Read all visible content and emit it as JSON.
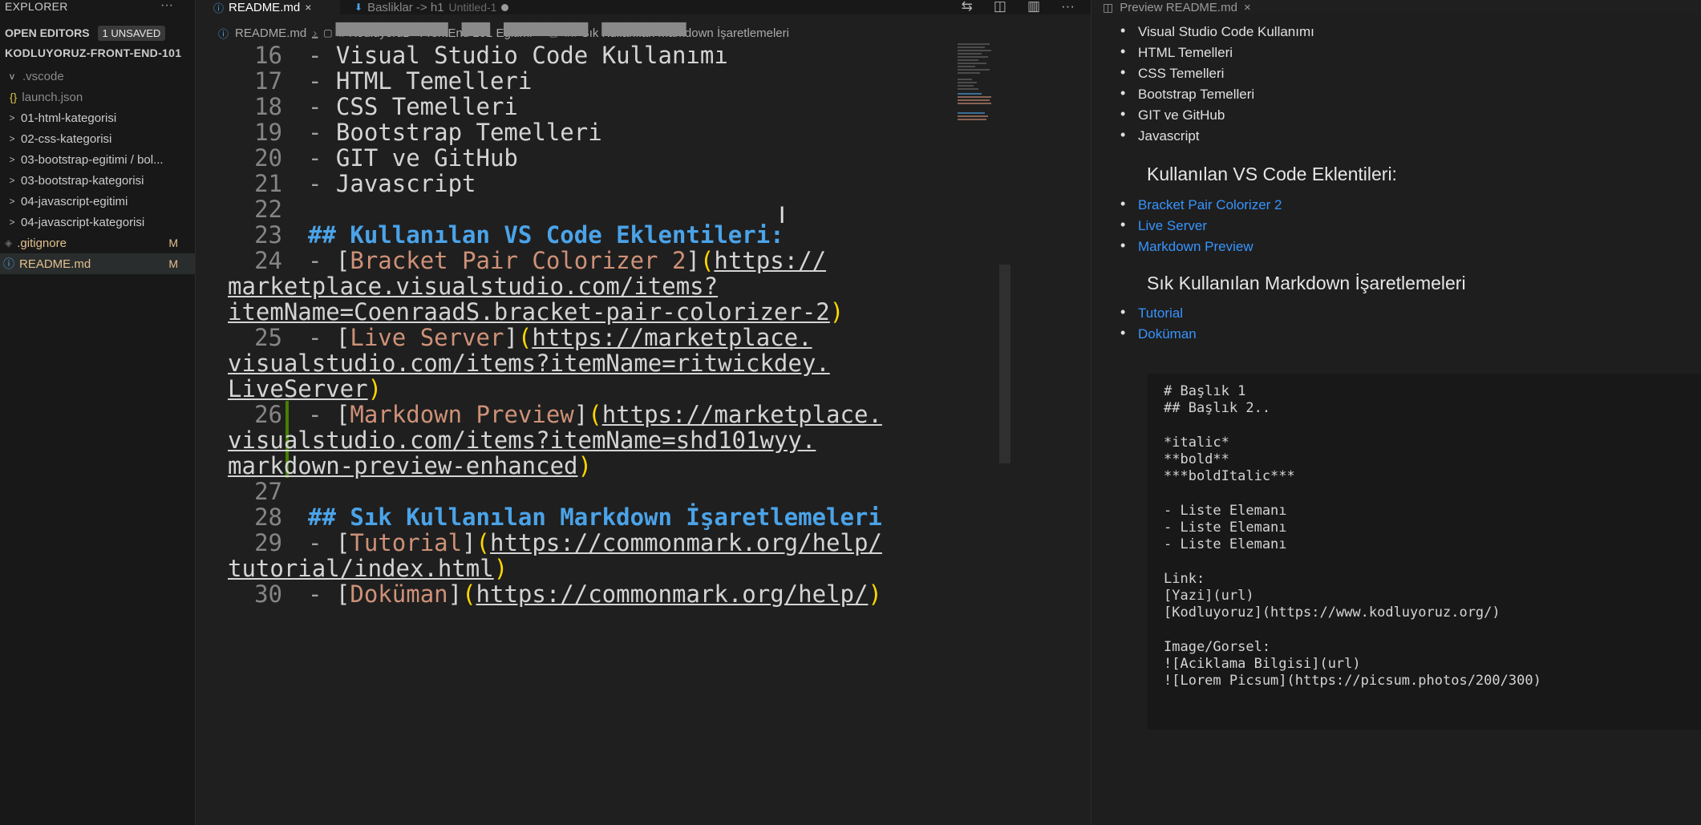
{
  "sidebar": {
    "title": "EXPLORER",
    "more": "···",
    "open_editors": {
      "label": "OPEN EDITORS",
      "badge": "1 UNSAVED"
    },
    "root": "KODLUYORUZ-FRONT-END-101",
    "items": [
      {
        "label": ".vscode",
        "chevron": "v"
      },
      {
        "label": "launch.json",
        "icon": "{}"
      },
      {
        "label": "01-html-kategorisi",
        "chevron": ">"
      },
      {
        "label": "02-css-kategorisi",
        "chevron": ">"
      },
      {
        "label": "03-bootstrap-egitimi / bol...",
        "chevron": ">"
      },
      {
        "label": "03-bootstrap-kategorisi",
        "chevron": ">"
      },
      {
        "label": "04-javascript-egitimi",
        "chevron": ">"
      },
      {
        "label": "04-javascript-kategorisi",
        "chevron": ">"
      },
      {
        "label": ".gitignore",
        "status": "M",
        "icon": "◈"
      },
      {
        "label": "README.md",
        "status": "M",
        "icon": "ⓘ"
      }
    ]
  },
  "tabs": [
    {
      "label": "README.md",
      "close": "×"
    },
    {
      "label": "Basliklar -> h1",
      "secondary": "Untitled-1"
    }
  ],
  "preview_tab": {
    "label": "Preview README.md",
    "close": "×"
  },
  "toolbar": {
    "icons": [
      "compare-icon",
      "open-preview-icon",
      "split-editor-icon",
      "more-actions-icon"
    ],
    "more": "···"
  },
  "breadcrumb": [
    "README.md",
    "# Kodluyoruz - FrontEnd 101 Eğitimi",
    "## Sık Kullanılan Markdown İşaretlemeleri"
  ],
  "editor": {
    "line_numbers": {
      "l16": "16",
      "l17": "17",
      "l18": "18",
      "l19": "19",
      "l20": "20",
      "l21": "21",
      "l22": "22",
      "l23": "23",
      "l24": "24",
      "l25": "25",
      "l26": "26",
      "l27": "27",
      "l28": "28",
      "l29": "29",
      "l30": "30"
    },
    "lines": {
      "l16": "Visual Studio Code Kullanımı",
      "l17": "HTML Temelleri",
      "l18": "CSS Temelleri",
      "l19": "Bootstrap Temelleri",
      "l20": "GIT ve GitHub",
      "l21": "Javascript",
      "l23": "## Kullanılan VS Code Eklentileri:",
      "l24_text": "Bracket Pair Colorizer 2",
      "l24_url_a": "https://",
      "l24_url_b": "marketplace.visualstudio.com/items?",
      "l24_url_c": "itemName=CoenraadS.bracket-pair-colorizer-2",
      "l25_text": "Live Server",
      "l25_url_a": "https://marketplace.",
      "l25_url_b": "visualstudio.com/items?itemName=ritwickdey.",
      "l25_url_c": "LiveServer",
      "l26_text": "Markdown Preview",
      "l26_url_a": "https://marketplace.",
      "l26_url_b": "visualstudio.com/items?itemName=shd101wyy.",
      "l26_url_c": "markdown-preview-enhanced",
      "l28": "## Sık Kullanılan Markdown İşaretlemeleri",
      "l29_text": "Tutorial",
      "l29_url_a": "https://commonmark.org/help/",
      "l29_url_b": "tutorial/index.html",
      "l30_text": "Doküman",
      "l30_url": "https://commonmark.org/help/"
    }
  },
  "preview": {
    "topics": [
      "Visual Studio Code Kullanımı",
      "HTML Temelleri",
      "CSS Temelleri",
      "Bootstrap Temelleri",
      "GIT ve GitHub",
      "Javascript"
    ],
    "h2_extensions": "Kullanılan VS Code Eklentileri:",
    "extensions": [
      "Bracket Pair Colorizer 2",
      "Live Server",
      "Markdown Preview"
    ],
    "h2_markdown": "Sık Kullanılan Markdown İşaretlemeleri",
    "markdown_links": [
      "Tutorial",
      "Doküman"
    ],
    "code": [
      "# Başlık 1",
      "## Başlık 2..",
      "",
      "*italic*",
      "**bold**",
      "***boldItalic***",
      "",
      "- Liste Elemanı",
      "- Liste Elemanı",
      "- Liste Elemanı",
      "",
      "Link:",
      "[Yazi](url)",
      "[Kodluyoruz](https://www.kodluyoruz.org/)",
      "",
      "Image/Gorsel:",
      "![Aciklama Bilgisi](url)",
      "![Lorem Picsum](https://picsum.photos/200/300)"
    ]
  },
  "colors": {
    "heading": "#4ba3e8",
    "link_text": "#ce9178",
    "link": "#3794ff",
    "modified": "#e2c08d"
  }
}
